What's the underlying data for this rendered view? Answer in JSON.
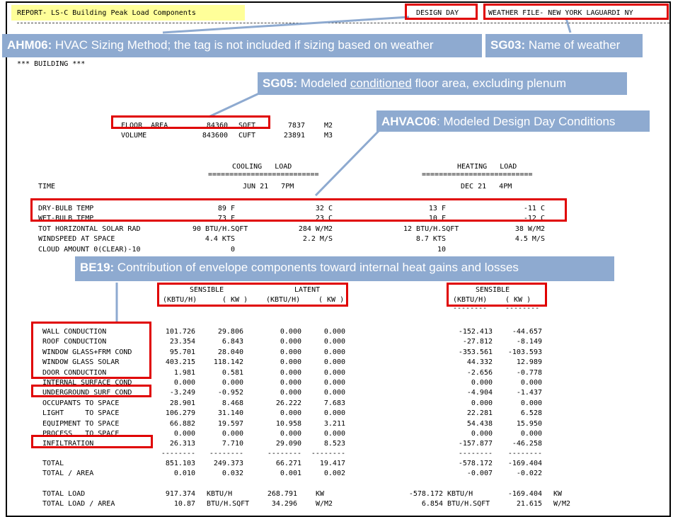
{
  "header": {
    "report_title": "REPORT- LS-C Building Peak Load Components",
    "design_day": "DESIGN DAY",
    "weather_file": "WEATHER FILE- NEW YORK LAGUARDI NY"
  },
  "building_label": "*** BUILDING ***",
  "floor_area": {
    "label": "FLOOR  AREA",
    "value": "84360",
    "unit": "SQFT",
    "metric": "7837",
    "metric_unit": "M2"
  },
  "volume": {
    "label": "VOLUME",
    "value": "843600",
    "unit": "CUFT",
    "metric": "23891",
    "metric_unit": "M3"
  },
  "cooling_header": "COOLING   LOAD",
  "heating_header": "HEATING   LOAD",
  "rule_eq": "==========================",
  "time": {
    "label": "TIME",
    "cooling": "JUN 21   7PM",
    "heating": "DEC 21   4PM"
  },
  "conditions": [
    {
      "label": "DRY-BULB TEMP",
      "c1": "89 F",
      "c2": "32 C",
      "h1": "13 F",
      "h2": "-11 C"
    },
    {
      "label": "WET-BULB TEMP",
      "c1": "73 F",
      "c2": "23 C",
      "h1": "10 F",
      "h2": "-12 C"
    },
    {
      "label": "TOT HORIZONTAL SOLAR RAD",
      "c1": "90 BTU/H.SQFT",
      "c2": "284 W/M2",
      "h1": "12 BTU/H.SQFT",
      "h2": "38 W/M2"
    },
    {
      "label": "WINDSPEED AT SPACE",
      "c1": "4.4 KTS",
      "c2": "2.2 M/S",
      "h1": "8.7 KTS",
      "h2": "4.5 M/S"
    },
    {
      "label": "CLOUD AMOUNT 0(CLEAR)-10",
      "c1": "0",
      "c2": "",
      "h1": "10",
      "h2": ""
    }
  ],
  "sensible_label": "SENSIBLE",
  "latent_label": "LATENT",
  "col_kbtu": "(KBTU/H)",
  "col_kw": "( KW )",
  "rule_dash": "--------",
  "rule_eq_short": "========================",
  "components": [
    {
      "label": "WALL CONDUCTION",
      "cs": "101.726",
      "ck": "29.806",
      "ls": "0.000",
      "lk": "0.000",
      "hs": "-152.413",
      "hk": "-44.657"
    },
    {
      "label": "ROOF CONDUCTION",
      "cs": "23.354",
      "ck": "6.843",
      "ls": "0.000",
      "lk": "0.000",
      "hs": "-27.812",
      "hk": "-8.149"
    },
    {
      "label": "WINDOW GLASS+FRM COND",
      "cs": "95.701",
      "ck": "28.040",
      "ls": "0.000",
      "lk": "0.000",
      "hs": "-353.561",
      "hk": "-103.593"
    },
    {
      "label": "WINDOW GLASS SOLAR",
      "cs": "403.215",
      "ck": "118.142",
      "ls": "0.000",
      "lk": "0.000",
      "hs": "44.332",
      "hk": "12.989"
    },
    {
      "label": "DOOR CONDUCTION",
      "cs": "1.981",
      "ck": "0.581",
      "ls": "0.000",
      "lk": "0.000",
      "hs": "-2.656",
      "hk": "-0.778"
    },
    {
      "label": "INTERNAL SURFACE COND",
      "cs": "0.000",
      "ck": "0.000",
      "ls": "0.000",
      "lk": "0.000",
      "hs": "0.000",
      "hk": "0.000"
    },
    {
      "label": "UNDERGROUND SURF COND",
      "cs": "-3.249",
      "ck": "-0.952",
      "ls": "0.000",
      "lk": "0.000",
      "hs": "-4.904",
      "hk": "-1.437"
    },
    {
      "label": "OCCUPANTS TO SPACE",
      "cs": "28.901",
      "ck": "8.468",
      "ls": "26.222",
      "lk": "7.683",
      "hs": "0.000",
      "hk": "0.000"
    },
    {
      "label": "LIGHT     TO SPACE",
      "cs": "106.279",
      "ck": "31.140",
      "ls": "0.000",
      "lk": "0.000",
      "hs": "22.281",
      "hk": "6.528"
    },
    {
      "label": "EQUIPMENT TO SPACE",
      "cs": "66.882",
      "ck": "19.597",
      "ls": "10.958",
      "lk": "3.211",
      "hs": "54.438",
      "hk": "15.950"
    },
    {
      "label": "PROCESS   TO SPACE",
      "cs": "0.000",
      "ck": "0.000",
      "ls": "0.000",
      "lk": "0.000",
      "hs": "0.000",
      "hk": "0.000"
    },
    {
      "label": "INFILTRATION",
      "cs": "26.313",
      "ck": "7.710",
      "ls": "29.090",
      "lk": "8.523",
      "hs": "-157.877",
      "hk": "-46.258"
    }
  ],
  "totals": [
    {
      "label": "TOTAL",
      "cs": "851.103",
      "ck": "249.373",
      "ls": "66.271",
      "lk": "19.417",
      "hs": "-578.172",
      "hk": "-169.404"
    },
    {
      "label": "TOTAL / AREA",
      "cs": "0.010",
      "ck": "0.032",
      "ls": "0.001",
      "lk": "0.002",
      "hs": "-0.007",
      "hk": "-0.022"
    }
  ],
  "total_load": {
    "label": "TOTAL LOAD",
    "cv1": "917.374",
    "cu1": "KBTU/H",
    "cv2": "268.791",
    "cu2": "KW",
    "hv1": "-578.172",
    "hu1": "KBTU/H",
    "hv2": "-169.404",
    "hu2": "KW"
  },
  "total_load_area": {
    "label": "TOTAL LOAD / AREA",
    "cv1": "10.87",
    "cu1": "BTU/H.SQFT",
    "cv2": "34.296",
    "cu2": "W/M2",
    "hv1": "6.854",
    "hu1": "BTU/H.SQFT",
    "hv2": "21.615",
    "hu2": "W/M2"
  },
  "callouts": {
    "ahm06": {
      "tag": "AHM06:",
      "text": " HVAC Sizing Method; the tag is not included if sizing based on weather"
    },
    "sg03": {
      "tag": "SG03:",
      "text": " Name of weather"
    },
    "sg05": {
      "tag": "SG05:",
      "pre": " Modeled ",
      "underlined": "conditioned",
      "post": " floor area, excluding plenum"
    },
    "ahvac06": {
      "tag": "AHVAC06",
      "text": ": Modeled Design Day Conditions"
    },
    "be19": {
      "tag": "BE19:",
      "text": " Contribution of envelope components toward internal heat gains and losses"
    }
  },
  "colors": {
    "highlight_red": "#e00000",
    "callout_blue": "#8eaad0",
    "title_highlight": "#ffff99"
  }
}
